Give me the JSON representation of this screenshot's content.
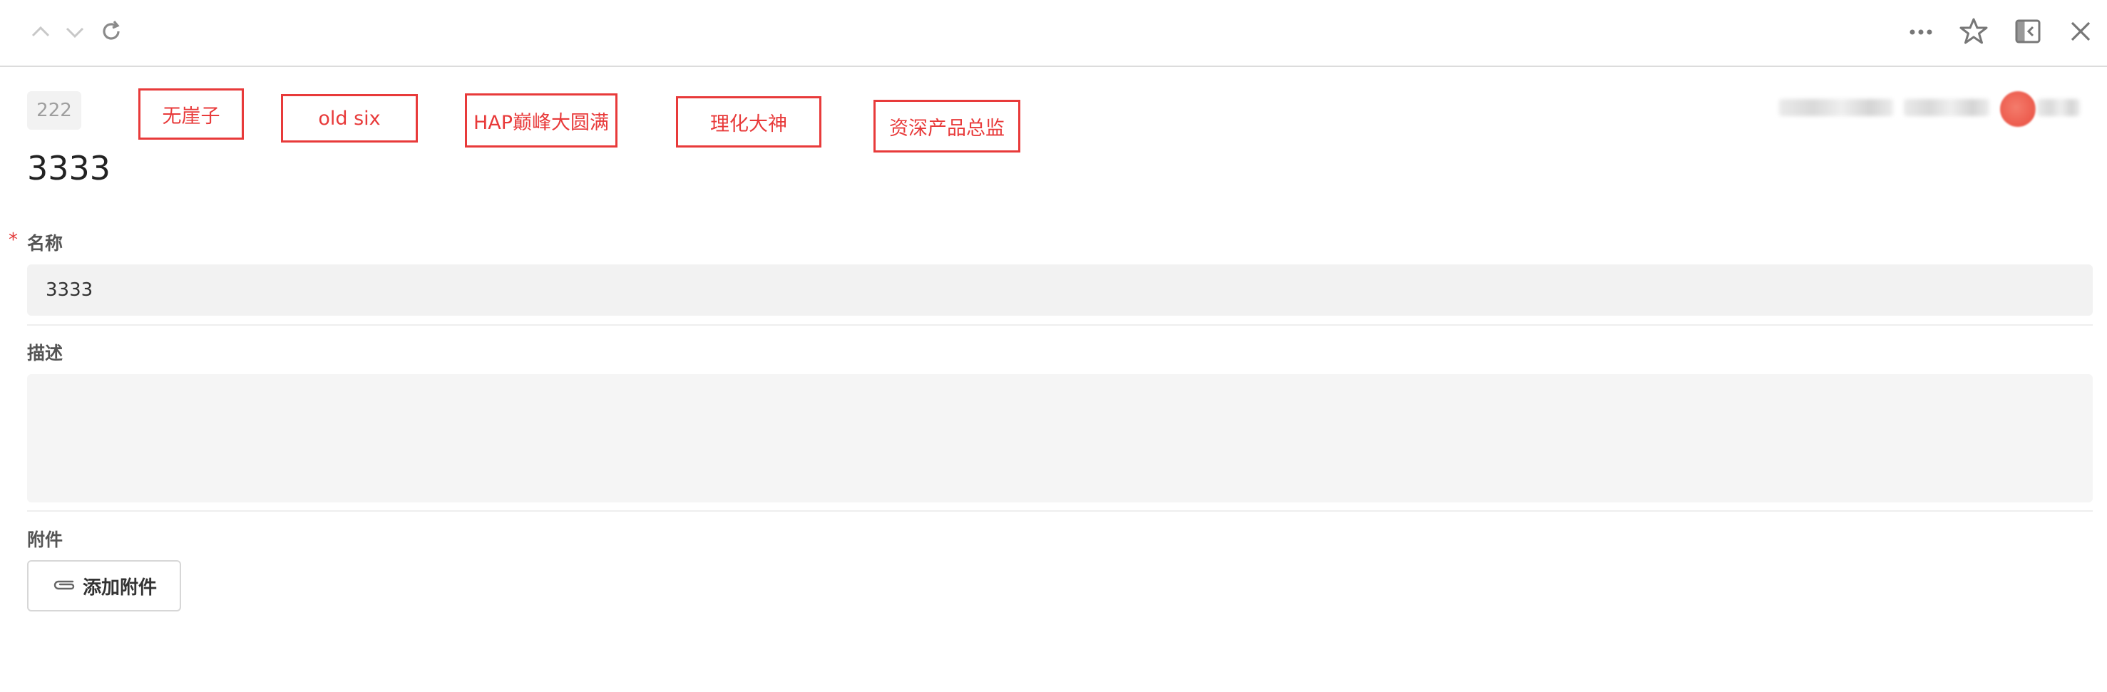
{
  "toolbar": {
    "icons": [
      "chevron-up-icon",
      "chevron-down-icon",
      "refresh-icon",
      "more-icon",
      "star-icon",
      "sidebar-collapse-icon",
      "close-icon"
    ]
  },
  "record": {
    "tag": "222",
    "title": "3333"
  },
  "annotations": [
    "无崖子",
    "old six",
    "HAP巅峰大圆满",
    "理化大神",
    "资深产品总监"
  ],
  "form": {
    "name_label": "名称",
    "required_mark": "*",
    "name_value": "3333",
    "desc_label": "描述",
    "desc_value": "",
    "attach_label": "附件",
    "attach_button": "添加附件"
  },
  "colors": {
    "annotation": "#e83a3a",
    "input_bg": "#f2f2f2",
    "required": "#e23b3b"
  }
}
